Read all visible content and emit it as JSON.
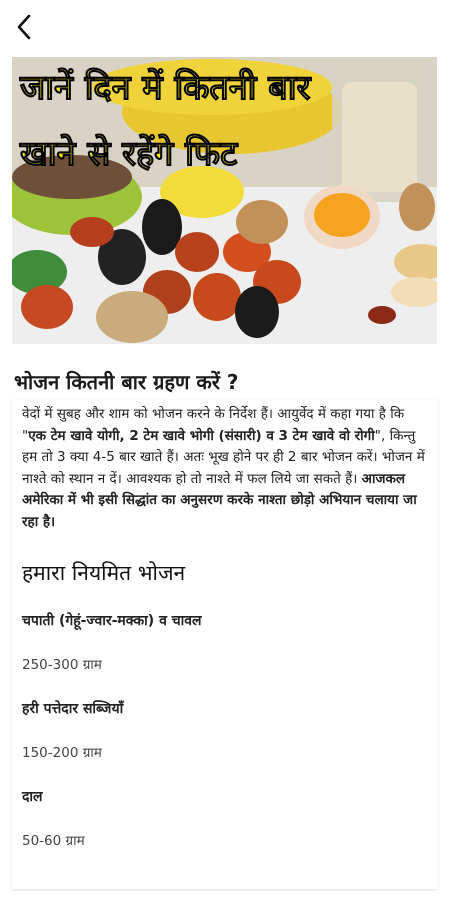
{
  "nav": {
    "back_icon": "chevron-left-icon"
  },
  "hero": {
    "line1": "जानें दिन में कितनी बार",
    "line2": "खाने से रहेंगे फिट",
    "text_color": "#f5e51b"
  },
  "article": {
    "heading": "भोजन कितनी बार ग्रहण करें ?",
    "para": {
      "p1": " वेदों में सुबह और शाम को भोजन करने के निर्देश हैं। आयुर्वेद में कहा गया है कि \"",
      "p1_bold": "एक टेम खावे योगी, 2 टेम खावे भोगी (संसारी) व 3 टेम खावे वो रोगी",
      "p2": "\", किन्तु हम तो 3 क्या 4-5 बार खाते हैं। अतः भूख होने पर ही 2 बार भोजन करें। भोजन में नाश्ते को स्थान न दें। आवश्यक हो तो नाश्ते में फल लिये जा सकते हैं। ",
      "p2_bold": "आजकल अमेरिका में भी इसी सिद्धांत का अनुसरण करके नाश्ता छोड़ो अभियान चलाया जा रहा है।"
    },
    "subheading": "हमारा नियमित भोजन",
    "items": [
      {
        "label": "चपाती (गेहूं-ज्वार-मक्का) व चावल",
        "value": "250-300 ग्राम"
      },
      {
        "label": "हरी पत्तेदार सब्जियाँ",
        "value": "150-200 ग्राम"
      },
      {
        "label": "दाल",
        "value": "50-60 ग्राम"
      }
    ]
  }
}
